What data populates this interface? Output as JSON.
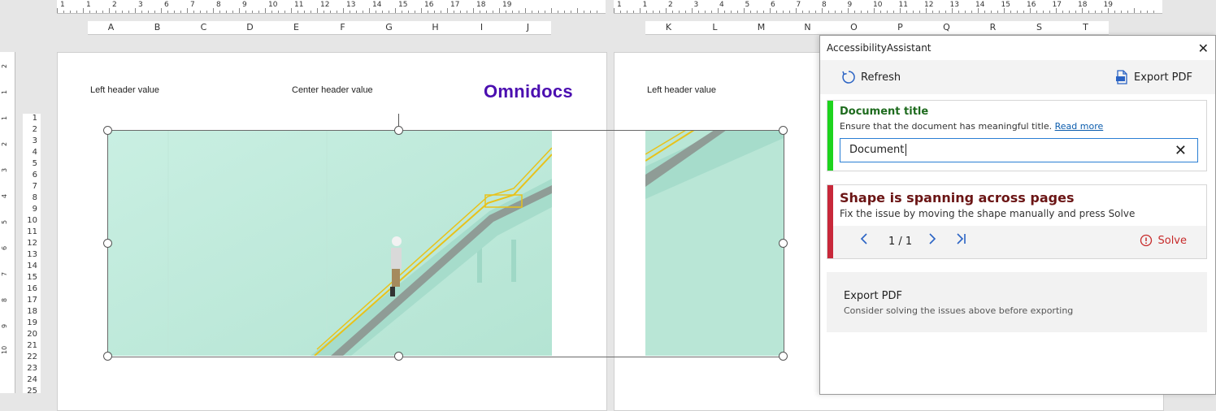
{
  "ruler": {
    "left_numbers": [
      "1",
      "1",
      "2",
      "3",
      "6",
      "7",
      "8",
      "9",
      "10",
      "11",
      "12",
      "13",
      "14",
      "15",
      "16",
      "17",
      "18",
      "19"
    ],
    "right_numbers": [
      "1",
      "1",
      "2",
      "3",
      "4",
      "5",
      "6",
      "7",
      "8",
      "9",
      "10",
      "11",
      "12",
      "13",
      "14",
      "15",
      "16",
      "17",
      "18",
      "19"
    ]
  },
  "columns": {
    "left": [
      "A",
      "B",
      "C",
      "D",
      "E",
      "F",
      "G",
      "H",
      "I",
      "J"
    ],
    "right": [
      "K",
      "L",
      "M",
      "N",
      "O",
      "P",
      "Q",
      "R",
      "S",
      "T"
    ]
  },
  "rows": [
    "1",
    "2",
    "3",
    "4",
    "5",
    "6",
    "7",
    "8",
    "9",
    "10",
    "11",
    "12",
    "13",
    "14",
    "15",
    "16",
    "17",
    "18",
    "19",
    "20",
    "21",
    "22",
    "23",
    "24",
    "25"
  ],
  "vruler_numbers": [
    "2",
    "1",
    "1",
    "2",
    "3",
    "4",
    "5",
    "6",
    "7",
    "8",
    "9",
    "10"
  ],
  "page1": {
    "left_header": "Left header value",
    "center_header": "Center header value",
    "logo": "Omnidocs"
  },
  "page2": {
    "left_header": "Left header value"
  },
  "panel": {
    "title": "AccessibilityAssistant",
    "close_icon": "close-icon",
    "refresh_label": "Refresh",
    "export_label": "Export PDF",
    "doc_title_card": {
      "title": "Document title",
      "description": "Ensure that the document has meaningful title.",
      "link": "Read more",
      "input_value": "Document",
      "accent": "#1ed41e"
    },
    "shape_card": {
      "title": "Shape is spanning across pages",
      "description": "Fix the issue by moving the shape manually and press Solve",
      "pager": "1 / 1",
      "solve_label": "Solve",
      "accent": "#c8283a"
    },
    "export_section": {
      "title": "Export PDF",
      "description": "Consider solving the issues above before exporting"
    }
  }
}
